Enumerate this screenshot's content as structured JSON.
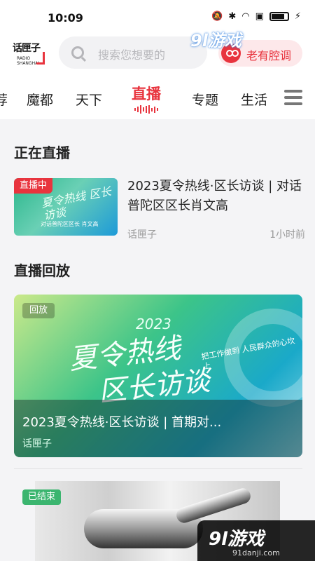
{
  "status_bar": {
    "time": "10:09",
    "battery_level": 0.8
  },
  "header": {
    "logo_text": "话匣子",
    "logo_sub": "RADIO SHANGHAI",
    "search_placeholder": "搜索您想要的",
    "listen_label": "老有腔调",
    "brand_color": "#e8343e"
  },
  "watermark": {
    "top_text": "9l游戏",
    "bottom_text": "9l游戏",
    "bottom_sub": "91danji.com"
  },
  "tabs": [
    {
      "label": "荐"
    },
    {
      "label": "魔都"
    },
    {
      "label": "天下"
    },
    {
      "label": "直播",
      "active": true
    },
    {
      "label": "专题"
    },
    {
      "label": "生活"
    }
  ],
  "sections": {
    "live_title": "正在直播",
    "replay_title": "直播回放"
  },
  "live_item": {
    "badge": "直播中",
    "thumb_text": "夏令热线 区长访谈",
    "thumb_caption": "对话普陀区区长 肖文高",
    "title": "2023夏令热线·区长访谈 | 对话普陀区区长肖文高",
    "source": "话匣子",
    "time": "1小时前"
  },
  "replay_item": {
    "badge": "回放",
    "year": "2023",
    "big_line1": "夏令热线",
    "big_line2": "区长访谈",
    "slogan": "把工作做到 人民群众的心坎上",
    "title": "2023夏令热线·区长访谈 | 首期对...",
    "source": "话匣子"
  },
  "ended_item": {
    "badge": "已结束"
  }
}
